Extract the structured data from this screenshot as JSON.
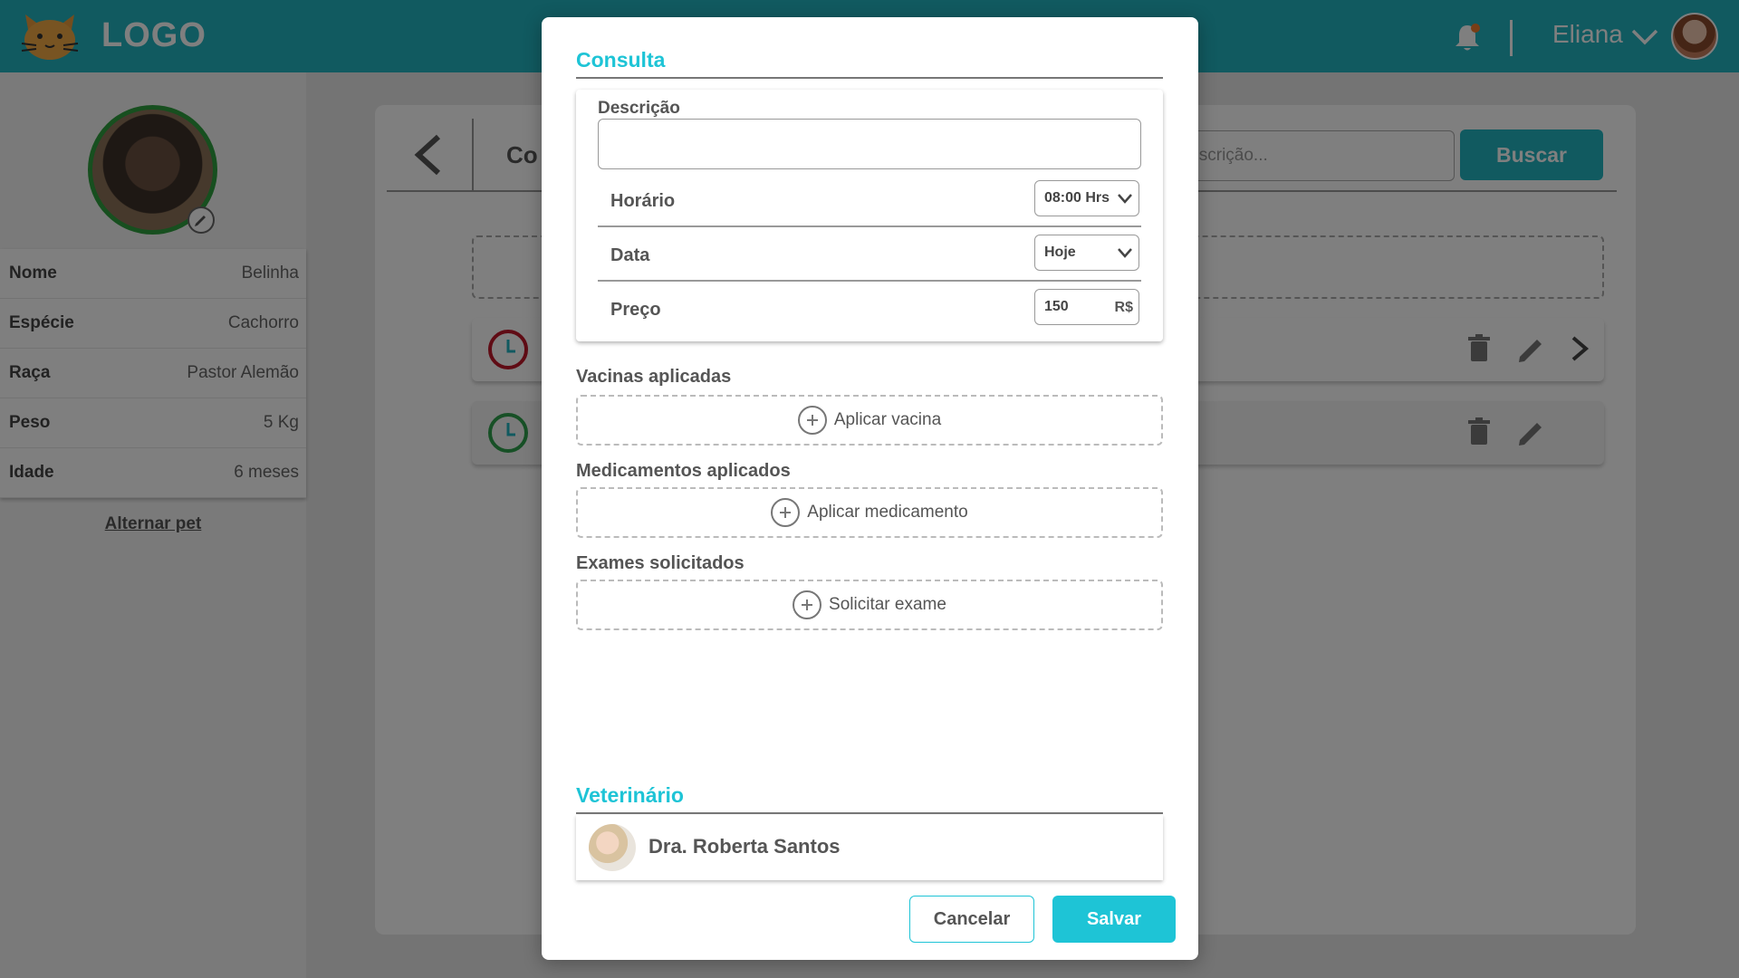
{
  "colors": {
    "brand": "#22b4c0",
    "modal_accent": "#1ec4d6",
    "pet_ring": "#2e9e3e",
    "clock_red": "#c0182b",
    "clock_green": "#2ea04c"
  },
  "header": {
    "logo_text": "LOGO",
    "user_name": "Eliana",
    "icons": [
      "cat-logo-icon",
      "bell-icon",
      "chevron-down-icon",
      "avatar"
    ]
  },
  "sidebar": {
    "pet_info": [
      {
        "key": "Nome",
        "value": "Belinha"
      },
      {
        "key": "Espécie",
        "value": "Cachorro"
      },
      {
        "key": "Raça",
        "value": "Pastor Alemão"
      },
      {
        "key": "Peso",
        "value": "5 Kg"
      },
      {
        "key": "Idade",
        "value": "6 meses"
      }
    ],
    "switch_pet": "Alternar pet"
  },
  "panel": {
    "title_partial": "Co",
    "search_placeholder_partial": "r descrição...",
    "search_button": "Buscar",
    "entries": [
      {
        "clock_color": "red"
      },
      {
        "clock_color": "green"
      }
    ]
  },
  "modal": {
    "title": "Consulta",
    "description_label": "Descrição",
    "description_value": "",
    "fields": [
      {
        "label": "Horário",
        "value": "08:00 Hrs",
        "kind": "select"
      },
      {
        "label": "Data",
        "value": "Hoje",
        "kind": "select"
      },
      {
        "label": "Preço",
        "value": "150",
        "unit": "R$",
        "kind": "input"
      }
    ],
    "vaccines": {
      "title": "Vacinas aplicadas",
      "button": "Aplicar vacina"
    },
    "medications": {
      "title": "Medicamentos aplicados",
      "button": "Aplicar medicamento"
    },
    "exams": {
      "title": "Exames solicitados",
      "button": "Solicitar exame"
    },
    "vet": {
      "title": "Veterinário",
      "name": "Dra. Roberta Santos"
    },
    "cancel": "Cancelar",
    "save": "Salvar"
  }
}
